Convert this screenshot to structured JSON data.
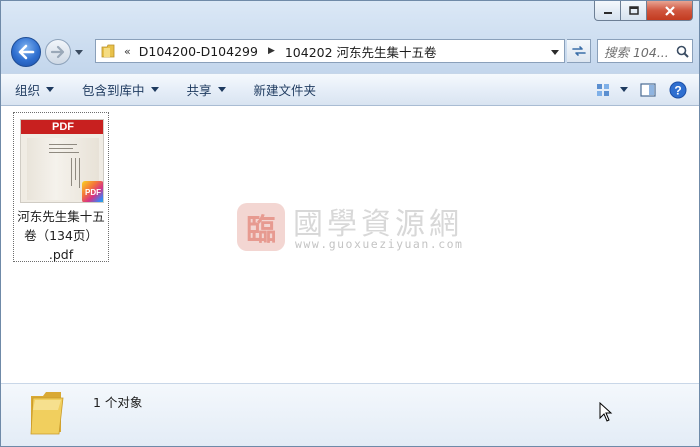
{
  "window": {
    "caption": {
      "minimize": "minimize",
      "maximize": "maximize",
      "close": "close"
    }
  },
  "nav": {
    "breadcrumb_overflow": "«",
    "breadcrumb": [
      "D104200-D104299",
      "104202 河东先生集十五卷"
    ],
    "search_placeholder": "搜索 104..."
  },
  "toolbar": {
    "organize": "组织",
    "include_in_library": "包含到库中",
    "share": "共享",
    "new_folder": "新建文件夹"
  },
  "files": [
    {
      "name_line1": "河东先生集十五",
      "name_line2": "卷（134页）",
      "name_line3": ".pdf",
      "thumb_label": "PDF",
      "badge": "PDF"
    }
  ],
  "watermark": {
    "seal": "臨",
    "title": "國學資源網",
    "url": "www.guoxueziyuan.com"
  },
  "details": {
    "count_text": "1 个对象"
  },
  "colors": {
    "accent_blue": "#2f6fd0",
    "close_red": "#c33b20",
    "pdf_red": "#c8201f"
  }
}
